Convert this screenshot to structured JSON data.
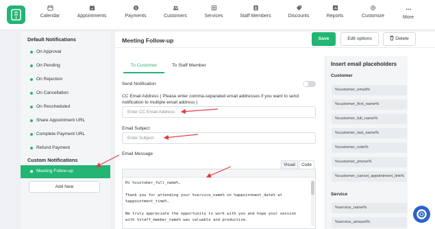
{
  "nav": {
    "items": [
      {
        "label": "Calendar",
        "icon": "calendar-icon"
      },
      {
        "label": "Appointments",
        "icon": "appointments-icon"
      },
      {
        "label": "Payments",
        "icon": "payments-icon"
      },
      {
        "label": "Customers",
        "icon": "customers-icon"
      },
      {
        "label": "Services",
        "icon": "services-icon"
      },
      {
        "label": "Staff Members",
        "icon": "staff-icon"
      },
      {
        "label": "Discounts",
        "icon": "discounts-icon"
      },
      {
        "label": "Reports",
        "icon": "reports-icon"
      },
      {
        "label": "Customize",
        "icon": "customize-icon"
      },
      {
        "label": "More",
        "icon": "more-icon"
      }
    ]
  },
  "sidebar": {
    "default_title": "Default Notifications",
    "default_items": [
      {
        "label": "On Approval"
      },
      {
        "label": "On Pending"
      },
      {
        "label": "On Rejection"
      },
      {
        "label": "On Cancellation"
      },
      {
        "label": "On Rescheduled"
      },
      {
        "label": "Share Appointment URL"
      },
      {
        "label": "Complete Payment URL"
      },
      {
        "label": "Refund Payment"
      }
    ],
    "custom_title": "Custom Notifications",
    "custom_items": [
      {
        "label": "Meeting Follow-up",
        "active": true
      }
    ],
    "add_new": "Add New"
  },
  "main": {
    "title": "Meeting Follow-up",
    "save": "Save",
    "edit_options": "Edit options",
    "delete": "Delete",
    "tabs": [
      {
        "label": "To Customer",
        "active": true
      },
      {
        "label": "To Staff Member",
        "active": false
      }
    ],
    "send_notification_label": "Send Notification",
    "send_notification_on": false,
    "cc_label": "CC Email Address ( Please enter comma-separated email addresses if you want to send notification to multiple email address )",
    "cc_placeholder": "Enter CC Email Address",
    "subject_label": "Email Subject",
    "subject_placeholder": "Enter Subject",
    "message_label": "Email Message",
    "editor_tabs": [
      "Visual",
      "Code"
    ],
    "message_body": "Hi %customer_full_name%,\n\nThank you for attending your %service_name% on %appointment_date% at\n%appointment_time%.\n\nWe truly appreciate the opportunity to work with you and hope your session\nwith %staff_member_name% was valuable and productive."
  },
  "placeholders": {
    "title": "Insert email placeholders",
    "groups": [
      {
        "name": "Customer",
        "items": [
          "%customer_email%",
          "%customer_first_name%",
          "%customer_full_name%",
          "%customer_last_name%",
          "%customer_note%",
          "%customer_phone%",
          "%customer_cancel_appointment_link%"
        ]
      },
      {
        "name": "Service",
        "items": [
          "%service_name%",
          "%service_amount%"
        ]
      }
    ]
  },
  "colors": {
    "accent": "#22b573",
    "annotation_arrow": "#e23b3b",
    "help_button": "#2e62c7"
  }
}
